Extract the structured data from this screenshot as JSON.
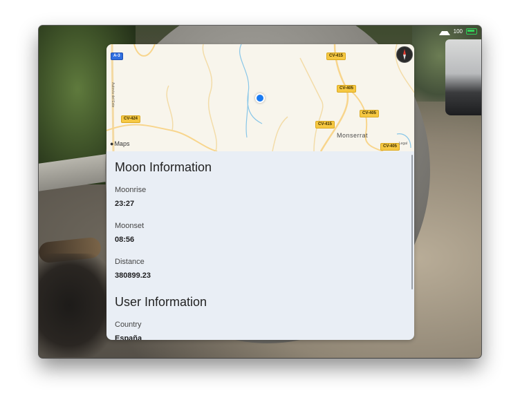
{
  "status_bar": {
    "battery_text": "100"
  },
  "map": {
    "road_badges": [
      {
        "label": "A-3",
        "style": "blue"
      },
      {
        "label": "CV-415",
        "style": "yellow"
      },
      {
        "label": "CV-405",
        "style": "yellow"
      },
      {
        "label": "CV-405",
        "style": "yellow"
      },
      {
        "label": "CV-424",
        "style": "yellow"
      },
      {
        "label": "CV-415",
        "style": "yellow"
      },
      {
        "label": "CV-405",
        "style": "yellow"
      }
    ],
    "town_label": "Monserrat",
    "highway_label": "Autovía del Este",
    "maps_brand": "Maps",
    "legal_link": "Legal"
  },
  "moon_section": {
    "title": "Moon Information",
    "fields": [
      {
        "label": "Moonrise",
        "value": "23:27"
      },
      {
        "label": "Moonset",
        "value": "08:56"
      },
      {
        "label": "Distance",
        "value": "380899.23"
      }
    ]
  },
  "user_section": {
    "title": "User Information",
    "fields": [
      {
        "label": "Country",
        "value": "España"
      }
    ]
  },
  "colors": {
    "panel_background": "#e9eef5",
    "location_dot": "#1a7bf2",
    "road_badge": "#f6c842",
    "highway_badge": "#2f6fe0"
  }
}
